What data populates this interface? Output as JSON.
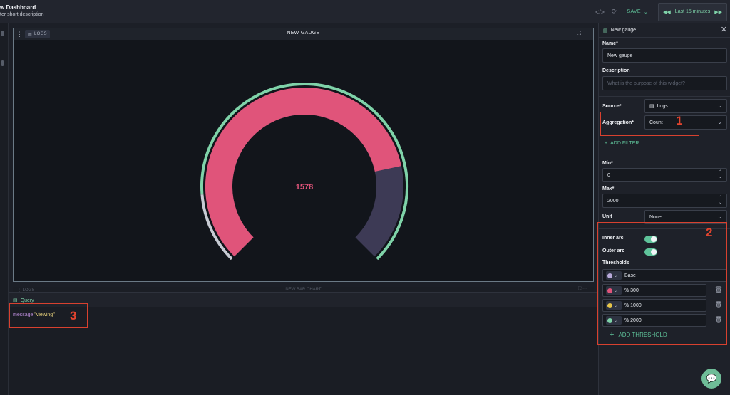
{
  "header": {
    "title": "w Dashboard",
    "description": "ter short description",
    "save_label": "SAVE",
    "time_range": "Last 15 minutes"
  },
  "widget": {
    "source_chip": "LOGS",
    "title": "NEW GAUGE",
    "value": "1578",
    "min": 0,
    "max": 2000,
    "value_fraction": 0.789
  },
  "widget2": {
    "source_chip": "LOGS",
    "title": "NEW BAR CHART"
  },
  "query": {
    "tab_label": "Query",
    "field": "message:",
    "value": "\"viewing\""
  },
  "panel": {
    "title": "New gauge",
    "name_label": "Name*",
    "name_value": "New gauge",
    "description_label": "Description",
    "description_placeholder": "What is the purpose of this widget?",
    "source_label": "Source*",
    "source_value": "Logs",
    "aggregation_label": "Aggregation*",
    "aggregation_value": "Count",
    "add_filter_label": "ADD FILTER",
    "min_label": "Min*",
    "min_value": "0",
    "max_label": "Max*",
    "max_value": "2000",
    "unit_label": "Unit",
    "unit_value": "None",
    "inner_arc_label": "Inner arc",
    "outer_arc_label": "Outer arc",
    "thresholds_label": "Thresholds",
    "thresholds": [
      {
        "label": "Base",
        "color": "#b8a9d9"
      },
      {
        "label": "% 300",
        "color": "#e0547a"
      },
      {
        "label": "% 1000",
        "color": "#e7c64a"
      },
      {
        "label": "% 2000",
        "color": "#7fd3a9"
      }
    ],
    "add_threshold_label": "ADD THRESHOLD"
  },
  "annotations": [
    "1",
    "2",
    "3"
  ],
  "colors": {
    "accent": "#5fc39a",
    "gauge_fill": "#e0547a",
    "gauge_track": "#3d3a55",
    "annotation": "#d8412f"
  }
}
